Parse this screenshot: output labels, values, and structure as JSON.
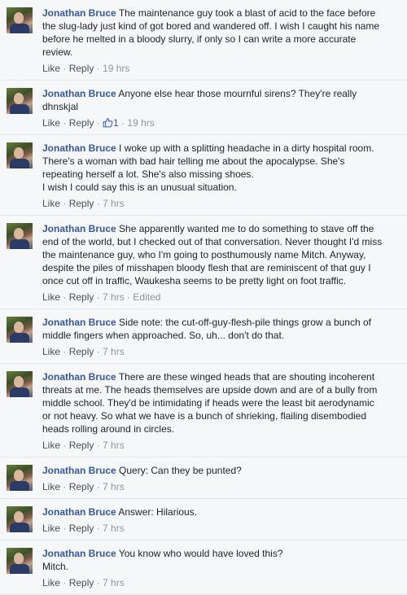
{
  "actions": {
    "like": "Like",
    "reply": "Reply",
    "sep": " · "
  },
  "comments": [
    {
      "author": "Jonathan Bruce",
      "lines": [
        "The maintenance guy took a blast of acid to the face before",
        "the slug-lady just kind of got bored and wandered off. I wish I caught his name",
        "before he melted in a bloody slurry, if only so I can write a more accurate",
        "review."
      ],
      "time": "19 hrs"
    },
    {
      "author": "Jonathan Bruce",
      "lines": [
        "Anyone else hear those mournful sirens? They're really",
        "dhnskjal"
      ],
      "time": "19 hrs",
      "likes": "1"
    },
    {
      "author": "Jonathan Bruce",
      "lines": [
        "I woke up with a splitting headache in a dirty hospital room.",
        "There's a woman with bad hair telling me about the apocalypse. She's",
        "repeating herself a lot. She's also missing shoes.",
        "I wish I could say this is an unusual situation."
      ],
      "time": "7 hrs"
    },
    {
      "author": "Jonathan Bruce",
      "lines": [
        "She apparently wanted me to do something to stave off the",
        "end of the world, but I checked out of that conversation. Never thought I'd miss",
        "the maintenance guy, who I'm going to posthumously name Mitch. Anyway,",
        "despite the piles of misshapen bloody flesh that are reminiscent of that guy I",
        "once cut off in traffic, Waukesha seems to be pretty light on foot traffic."
      ],
      "time": "7 hrs",
      "edited": "Edited"
    },
    {
      "author": "Jonathan Bruce",
      "lines": [
        "Side note: the cut-off-guy-flesh-pile things grow a bunch of",
        "middle fingers when approached. So, uh... don't do that."
      ],
      "time": "7 hrs"
    },
    {
      "author": "Jonathan Bruce",
      "lines": [
        "There are these winged heads that are shouting incoherent",
        "threats at me. The heads themselves are upside down and are of a bully from",
        "middle school. They'd be intimidating if heads were the least bit aerodynamic",
        "or not heavy. So what we have is a bunch of shrieking, flailing disembodied",
        "heads rolling around in circles."
      ],
      "time": "7 hrs"
    },
    {
      "author": "Jonathan Bruce",
      "lines": [
        "Query: Can they be punted?"
      ],
      "time": "7 hrs"
    },
    {
      "author": "Jonathan Bruce",
      "lines": [
        "Answer: Hilarious."
      ],
      "time": "7 hrs"
    },
    {
      "author": "Jonathan Bruce",
      "lines": [
        "You know who would have loved this?",
        "Mitch."
      ],
      "time": "7 hrs"
    }
  ]
}
